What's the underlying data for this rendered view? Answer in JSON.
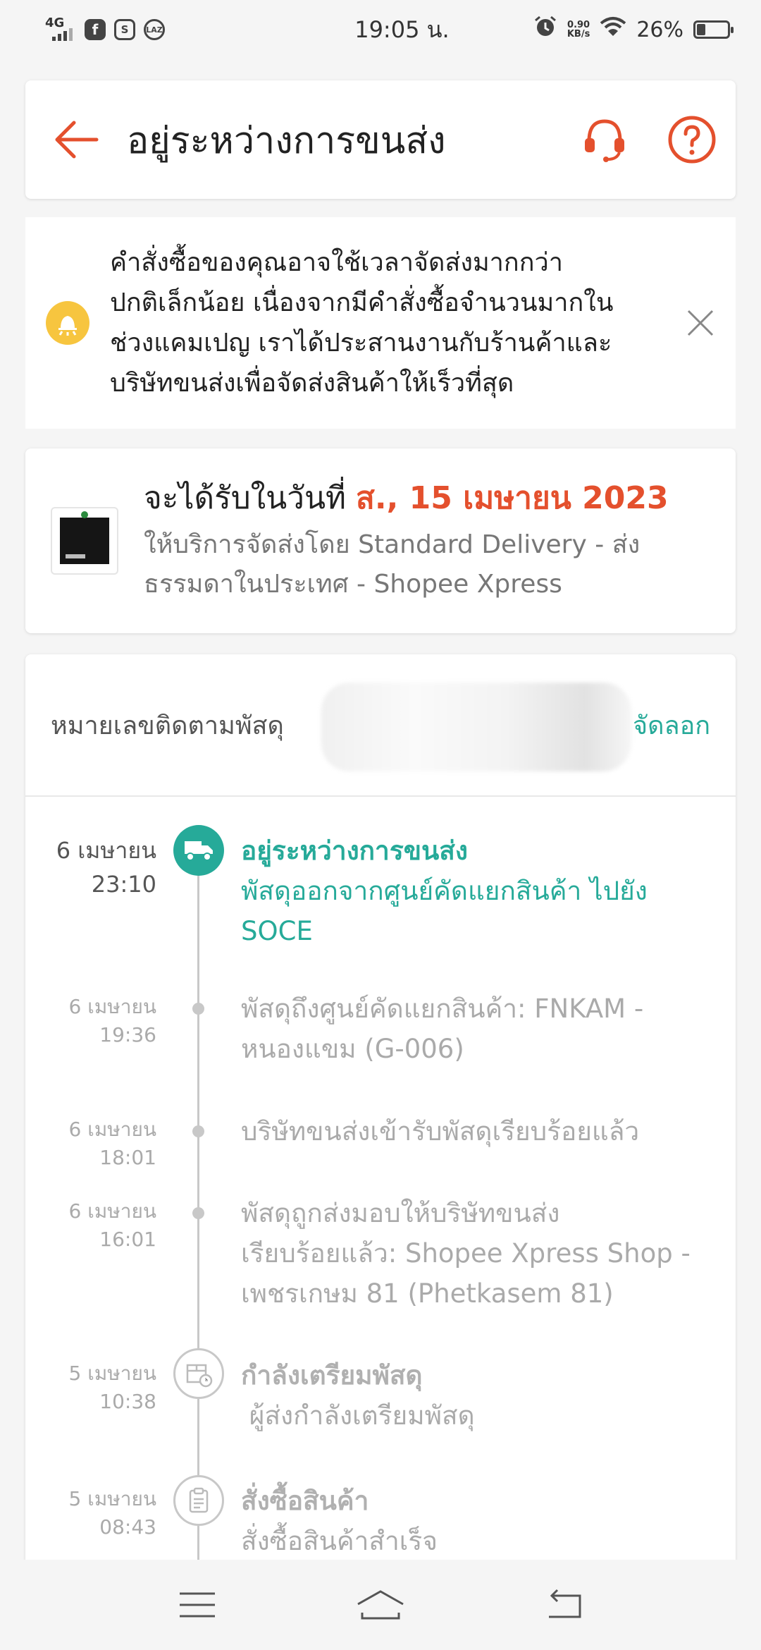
{
  "status_bar": {
    "network": "4G",
    "app_icons": [
      "facebook-icon",
      "s-app-icon",
      "laz-icon"
    ],
    "laz_label": "LAZ",
    "s_label": "S",
    "fb_label": "f",
    "time": "19:05 น.",
    "speed_value": "0.90",
    "speed_unit": "KB/s",
    "battery": "26%",
    "battery_level": 0.26
  },
  "header": {
    "title": "อยู่ระหว่างการขนส่ง",
    "colors": {
      "accent": "#e4502d"
    }
  },
  "notice": {
    "text_lines": [
      "คำสั่งซื้อของคุณอาจใช้เวลาจัดส่งมากกว่า",
      "ปกติเล็กน้อย เนื่องจากมีคำสั่งซื้อจำนวนมากใน",
      "ช่วงแคมเปญ เราได้ประสานงานกับร้านค้าและ",
      "บริษัทขนส่งเพื่อจัดส่งสินค้าให้เร็วที่สุด"
    ]
  },
  "delivery": {
    "prefix": "จะได้รับในวันที่ ",
    "date": "ส., 15 เมษายน 2023",
    "service_line1": "ให้บริการจัดส่งโดย Standard Delivery - ส่ง",
    "service_line2": "ธรรมดาในประเทศ - Shopee Xpress"
  },
  "tracking": {
    "label": "หมายเลขติดตามพัสดุ",
    "copy_label": "คัดลอก",
    "copy_visible": "จัดลอก",
    "accent": "#26aa99",
    "events": [
      {
        "date": "6 เมษายน",
        "time": "23:10",
        "title": "อยู่ระหว่างการขนส่ง",
        "lines": [
          "พัสดุออกจากศูนย์คัดแยกสินค้า ไปยัง",
          "SOCE"
        ],
        "icon": "truck-icon",
        "state": "active"
      },
      {
        "date": "6 เมษายน",
        "time": "19:36",
        "lines": [
          "พัสดุถึงศูนย์คัดแยกสินค้า: FNKAM -",
          "หนองแขม (G-006)"
        ],
        "state": "past"
      },
      {
        "date": "6 เมษายน",
        "time": "18:01",
        "lines": [
          "บริษัทขนส่งเข้ารับพัสดุเรียบร้อยแล้ว"
        ],
        "state": "past"
      },
      {
        "date": "6 เมษายน",
        "time": "16:01",
        "lines": [
          "พัสดุถูกส่งมอบให้บริษัทขนส่ง",
          "เรียบร้อยแล้ว: Shopee Xpress Shop -",
          "เพชรเกษม 81 (Phetkasem 81)"
        ],
        "state": "past"
      },
      {
        "date": "5 เมษายน",
        "time": "10:38",
        "title": "กำลังเตรียมพัสดุ",
        "lines": [
          " ผู้ส่งกำลังเตรียมพัสดุ"
        ],
        "icon": "package-clock-icon",
        "state": "milestone"
      },
      {
        "date": "5 เมษายน",
        "time": "08:43",
        "title": "สั่งซื้อสินค้า",
        "lines": [
          "สั่งซื้อสินค้าสำเร็จ"
        ],
        "icon": "clipboard-icon",
        "state": "milestone"
      }
    ]
  },
  "navbar": {
    "icons": [
      "menu-icon",
      "home-icon",
      "back-nav-icon"
    ]
  }
}
